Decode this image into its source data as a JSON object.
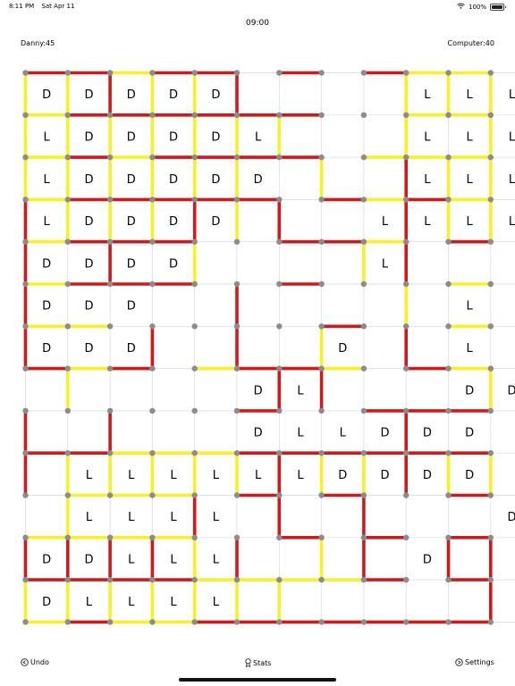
{
  "status_bar": {
    "time": "8:11 PM",
    "date": "Sat Apr 11",
    "battery": "100%"
  },
  "timer": "09:00",
  "scores": {
    "player_label": "Danny:45",
    "computer_label": "Computer:40"
  },
  "colors": {
    "player": "#f9f029",
    "computer": "#d01919",
    "dot": "#8c8c8c",
    "grid": "#d8d8d8"
  },
  "board": {
    "cols": 11,
    "rows": 13,
    "cells": [
      "DDDDD....LLL",
      "LDDDDL...LLL",
      "LDDDDD...LLL",
      "LDDDD...LLLL",
      "DDDD....L...",
      "DDD.......L.",
      "DDD....D..L.",
      ".....DL...DD",
      ".....DLLDDD.",
      ".LLLLLLDDDD.",
      ".LLLL......D",
      "DDLLL....D..",
      "DLLLL......."
    ],
    "h_lines": [
      "RRYRR.R.RYY",
      "YRRRRRR..YY",
      "YRYRRRR.YYY",
      "YRRRRR.RYRY",
      "YRRR..RRY.R",
      "YRRR..R...Y",
      "YY.....R..Y",
      "RYR.YRRY.RY",
      ".....R..RRR",
      "RRYYYRRRRRR",
      ".YYY.R.R..R",
      "YYYY..R.R.R",
      "RRRRYYYYR.R",
      "YRYYRRRRRRR"
    ],
    "v_lines": [
      "YYRYYR...YYYY",
      "YYYYYYY..Y.YY",
      "YYYYYY.Y.RYYY",
      "RYYYRYR..RYYY",
      "R.R.Y...YR..Y",
      "R....R...Y..Y",
      "R..R.R.Y.R..Y",
      ".Y....RR...YY",
      "R.R......R..Y",
      "RYYYYYRYYRYYR",
      ".Y..R.R.R...R",
      "RRRRYR.YR.RR.",
      "YYYYYYY....RRR"
    ]
  },
  "buttons": {
    "undo": "Undo",
    "stats": "Stats",
    "settings": "Settings"
  }
}
